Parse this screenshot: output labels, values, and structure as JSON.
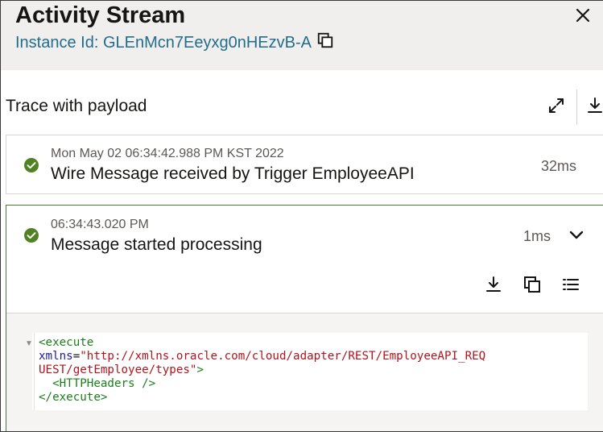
{
  "header": {
    "title": "Activity Stream",
    "instance_text": "Instance Id: GLEnMcn7Eeyxg0nHEzvB-A"
  },
  "trace": {
    "label": "Trace with payload"
  },
  "activities": [
    {
      "timestamp": "Mon May 02 06:34:42.988 PM KST 2022",
      "message": "Wire Message received by Trigger EmployeeAPI",
      "duration": "32ms",
      "status": "success"
    },
    {
      "timestamp": "06:34:43.020 PM",
      "message": "Message started processing",
      "duration": "1ms",
      "status": "success",
      "expanded": true
    }
  ],
  "payload": {
    "line1_tag": "<execute",
    "attr_name": "xmlns",
    "attr_eq": "=",
    "attr_value_part1": "\"http://xmlns.oracle.com/cloud/adapter/REST/EmployeeAPI_REQ",
    "attr_value_part2": "UEST/getEmployee/types\"",
    "attr_close": ">",
    "child": "  <HTTPHeaders />",
    "close": "</execute>"
  },
  "colors": {
    "success": "#508223",
    "link": "#216e8c",
    "header_bg": "#f1efed"
  },
  "icons": {
    "close": "close-icon",
    "copy": "copy-icon",
    "expand": "expand-icon",
    "download": "download-icon",
    "check": "check-circle-icon",
    "chevron": "chevron-down-icon",
    "list": "list-icon"
  }
}
